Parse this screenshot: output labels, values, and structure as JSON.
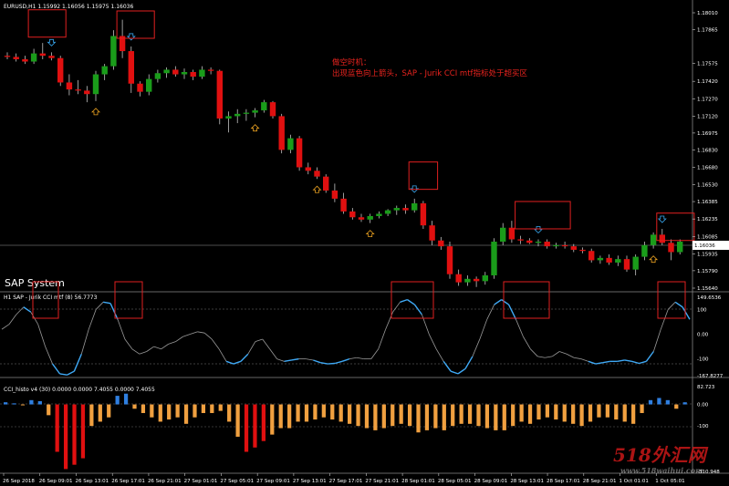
{
  "window": {
    "main_title": "EURUSD,H1  1.15992 1.16056 1.15975 1.16036",
    "sap_label": "SAP System",
    "ind1_title": "H1 SAP - Jurik CCI mtf (8) 56.7773",
    "ind2_title": "CCI_histo v4 (30) 0.0000 0.0000 7.4055 0.0000 7.4055"
  },
  "annotation": {
    "line1": "做空时机：",
    "line2": "出现蓝色向上箭头，SAP - Jurik CCI mtf指标处于超买区"
  },
  "price_axis": [
    "1.18010",
    "1.17865",
    "1.17575",
    "1.17420",
    "1.17270",
    "1.17120",
    "1.16975",
    "1.16830",
    "1.16680",
    "1.16530",
    "1.16385",
    "1.16235",
    "1.16085",
    "1.15935",
    "1.15790",
    "1.15640"
  ],
  "current_price": "1.16036",
  "ind1_axis": [
    "149.6536",
    "100",
    "0.00",
    "-100",
    "-167.8277"
  ],
  "ind2_axis": [
    "82.723",
    "0.00",
    "-100",
    "-310.948"
  ],
  "time_axis": [
    "26 Sep 2018",
    "26 Sep 09:01",
    "26 Sep 13:01",
    "26 Sep 17:01",
    "26 Sep 21:01",
    "27 Sep 01:01",
    "27 Sep 05:01",
    "27 Sep 09:01",
    "27 Sep 13:01",
    "27 Sep 17:01",
    "27 Sep 21:01",
    "28 Sep 01:01",
    "28 Sep 05:01",
    "28 Sep 09:01",
    "28 Sep 13:01",
    "28 Sep 17:01",
    "28 Sep 21:01",
    "1 Oct 01:01",
    "1 Oct 05:01"
  ],
  "watermark": {
    "text": "518外汇网",
    "sub": "www.518waihui.com"
  },
  "colors": {
    "bull": "#1a9c1a",
    "bear": "#e01010",
    "box": "#e02020",
    "cci_line_over": "#3fa9f5",
    "cci_line_mid": "#9a9a9a",
    "hist_up": "#2f7fe0",
    "hist_neg": "#f0a040",
    "hist_deep": "#e01010",
    "signal_up": "#e8a020",
    "signal_down": "#38a8f0"
  },
  "chart_data": [
    {
      "type": "candlestick",
      "title": "EURUSD,H1",
      "y_axis": [
        "1.18010",
        "1.17865",
        "1.17575",
        "1.17420",
        "1.17270",
        "1.17120",
        "1.16975",
        "1.16830",
        "1.16680",
        "1.16530",
        "1.16385",
        "1.16235",
        "1.16085",
        "1.15935",
        "1.15790",
        "1.15640"
      ],
      "ylim": [
        1.1564,
        1.1801
      ],
      "candles": [
        [
          1.1764,
          1.1767,
          1.1761,
          1.1763
        ],
        [
          1.1763,
          1.1766,
          1.1759,
          1.1761
        ],
        [
          1.1761,
          1.1764,
          1.1757,
          1.1759
        ],
        [
          1.1759,
          1.177,
          1.1757,
          1.1766
        ],
        [
          1.1766,
          1.1775,
          1.1761,
          1.1764
        ],
        [
          1.1764,
          1.1767,
          1.176,
          1.1762
        ],
        [
          1.1762,
          1.1764,
          1.1738,
          1.1741
        ],
        [
          1.1741,
          1.1748,
          1.173,
          1.1735
        ],
        [
          1.1735,
          1.1743,
          1.1731,
          1.1734
        ],
        [
          1.1734,
          1.1738,
          1.1724,
          1.1731
        ],
        [
          1.1731,
          1.1751,
          1.1725,
          1.1748
        ],
        [
          1.1748,
          1.1757,
          1.1743,
          1.1755
        ],
        [
          1.1755,
          1.1786,
          1.1752,
          1.1781
        ],
        [
          1.1781,
          1.1795,
          1.1762,
          1.1768
        ],
        [
          1.1768,
          1.1772,
          1.1732,
          1.174
        ],
        [
          1.174,
          1.1742,
          1.1729,
          1.1733
        ],
        [
          1.1733,
          1.1748,
          1.173,
          1.1744
        ],
        [
          1.1744,
          1.1752,
          1.1741,
          1.1749
        ],
        [
          1.1749,
          1.1754,
          1.1745,
          1.1752
        ],
        [
          1.1752,
          1.1755,
          1.1746,
          1.1748
        ],
        [
          1.1748,
          1.1753,
          1.1744,
          1.175
        ],
        [
          1.175,
          1.1752,
          1.1743,
          1.1746
        ],
        [
          1.1746,
          1.1755,
          1.1744,
          1.1752
        ],
        [
          1.1752,
          1.1754,
          1.1748,
          1.1751
        ],
        [
          1.1751,
          1.1752,
          1.1705,
          1.171
        ],
        [
          1.171,
          1.1716,
          1.1698,
          1.1712
        ],
        [
          1.1712,
          1.1718,
          1.1706,
          1.1714
        ],
        [
          1.1714,
          1.1718,
          1.1708,
          1.1715
        ],
        [
          1.1715,
          1.1719,
          1.1711,
          1.1717
        ],
        [
          1.1717,
          1.1726,
          1.1715,
          1.1724
        ],
        [
          1.1724,
          1.1725,
          1.171,
          1.1712
        ],
        [
          1.1712,
          1.1714,
          1.168,
          1.1683
        ],
        [
          1.1683,
          1.1696,
          1.168,
          1.1693
        ],
        [
          1.1693,
          1.1695,
          1.1665,
          1.1668
        ],
        [
          1.1668,
          1.1672,
          1.1662,
          1.1665
        ],
        [
          1.1665,
          1.1668,
          1.1658,
          1.166
        ],
        [
          1.166,
          1.1662,
          1.1646,
          1.1648
        ],
        [
          1.1648,
          1.1654,
          1.1638,
          1.1641
        ],
        [
          1.1641,
          1.1646,
          1.1628,
          1.163
        ],
        [
          1.163,
          1.1633,
          1.1623,
          1.1625
        ],
        [
          1.1625,
          1.1628,
          1.1621,
          1.1623
        ],
        [
          1.1623,
          1.1628,
          1.162,
          1.1626
        ],
        [
          1.1626,
          1.163,
          1.1624,
          1.1628
        ],
        [
          1.1628,
          1.1632,
          1.1626,
          1.1631
        ],
        [
          1.1631,
          1.1635,
          1.1627,
          1.1633
        ],
        [
          1.1633,
          1.1636,
          1.1628,
          1.1631
        ],
        [
          1.1631,
          1.1641,
          1.1629,
          1.1637
        ],
        [
          1.1637,
          1.1639,
          1.1615,
          1.1618
        ],
        [
          1.1618,
          1.1622,
          1.1601,
          1.1605
        ],
        [
          1.1605,
          1.1608,
          1.1597,
          1.16
        ],
        [
          1.16,
          1.1604,
          1.1572,
          1.1576
        ],
        [
          1.1576,
          1.158,
          1.1566,
          1.1569
        ],
        [
          1.1569,
          1.1575,
          1.1566,
          1.1572
        ],
        [
          1.1572,
          1.1574,
          1.1565,
          1.157
        ],
        [
          1.157,
          1.1578,
          1.1567,
          1.1575
        ],
        [
          1.1575,
          1.1607,
          1.1572,
          1.1604
        ],
        [
          1.1604,
          1.162,
          1.1601,
          1.1616
        ],
        [
          1.1616,
          1.1622,
          1.1603,
          1.1606
        ],
        [
          1.1606,
          1.1609,
          1.1602,
          1.1605
        ],
        [
          1.1605,
          1.1607,
          1.1602,
          1.1603
        ],
        [
          1.1603,
          1.1606,
          1.16,
          1.1604
        ],
        [
          1.1604,
          1.1606,
          1.1598,
          1.16
        ],
        [
          1.16,
          1.1603,
          1.1598,
          1.1601
        ],
        [
          1.1601,
          1.1604,
          1.1598,
          1.16
        ],
        [
          1.16,
          1.1602,
          1.1595,
          1.1597
        ],
        [
          1.1597,
          1.1599,
          1.1594,
          1.1596
        ],
        [
          1.1596,
          1.1598,
          1.1586,
          1.1588
        ],
        [
          1.1588,
          1.1592,
          1.1585,
          1.159
        ],
        [
          1.159,
          1.1593,
          1.1584,
          1.1586
        ],
        [
          1.1586,
          1.1592,
          1.1583,
          1.1589
        ],
        [
          1.1589,
          1.1592,
          1.1578,
          1.158
        ],
        [
          1.158,
          1.1593,
          1.1575,
          1.1591
        ],
        [
          1.1591,
          1.1604,
          1.1588,
          1.1601
        ],
        [
          1.1601,
          1.1612,
          1.1598,
          1.161
        ],
        [
          1.161,
          1.1615,
          1.1601,
          1.1603
        ],
        [
          1.1603,
          1.1606,
          1.1588,
          1.1595
        ],
        [
          1.1595,
          1.1606,
          1.1593,
          1.1604
        ]
      ],
      "current_price": 1.16036
    },
    {
      "type": "line",
      "title": "H1 SAP - Jurik CCI mtf (8) 56.7773",
      "y_axis": [
        "149.6536",
        "100",
        "0.00",
        "-100",
        "-167.8277"
      ],
      "ylim": [
        -167.8277,
        149.6536
      ],
      "levels": [
        100,
        -100
      ],
      "values": [
        20,
        40,
        80,
        110,
        90,
        40,
        -50,
        -120,
        -160,
        -165,
        -150,
        -80,
        20,
        100,
        130,
        125,
        60,
        -20,
        -60,
        -80,
        -70,
        -50,
        -60,
        -40,
        -30,
        -10,
        0,
        10,
        5,
        -20,
        -60,
        -110,
        -120,
        -110,
        -80,
        -30,
        -20,
        -60,
        -100,
        -110,
        -105,
        -100,
        -100,
        -105,
        -115,
        -120,
        -118,
        -110,
        -100,
        -95,
        -100,
        -100,
        -60,
        20,
        90,
        130,
        140,
        120,
        80,
        0,
        -60,
        -110,
        -150,
        -160,
        -140,
        -90,
        -20,
        60,
        120,
        140,
        120,
        60,
        -10,
        -60,
        -90,
        -95,
        -90,
        -70,
        -80,
        -95,
        -100,
        -110,
        -120,
        -115,
        -110,
        -110,
        -105,
        -110,
        -118,
        -110,
        -70,
        20,
        100,
        130,
        110,
        60
      ]
    },
    {
      "type": "bar",
      "title": "CCI_histo v4 (30) 0.0000 0.0000 7.4055 0.0000 7.4055",
      "y_axis": [
        "82.723",
        "0.00",
        "-100",
        "-310.948"
      ],
      "ylim": [
        -310.948,
        82.723
      ],
      "values": [
        10,
        5,
        0,
        20,
        15,
        -50,
        -220,
        -300,
        -280,
        -250,
        -100,
        -80,
        -60,
        40,
        50,
        -20,
        -40,
        -60,
        -80,
        -70,
        -60,
        -90,
        -60,
        -40,
        -40,
        -30,
        -80,
        -150,
        -220,
        -200,
        -170,
        -140,
        -110,
        -110,
        -80,
        -80,
        -70,
        -60,
        -70,
        -80,
        -90,
        -100,
        -110,
        -120,
        -110,
        -100,
        -90,
        -100,
        -130,
        -120,
        -110,
        -120,
        -100,
        -90,
        -90,
        -100,
        -110,
        -120,
        -120,
        -100,
        -80,
        -90,
        -70,
        -60,
        -70,
        -80,
        -90,
        -100,
        -80,
        -60,
        -60,
        -70,
        -80,
        -90,
        -40,
        20,
        30,
        20,
        -20,
        10
      ]
    }
  ]
}
